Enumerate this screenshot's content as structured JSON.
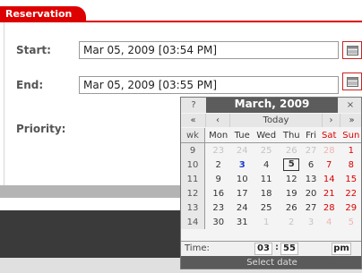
{
  "tab": {
    "label": "Reservation"
  },
  "form": {
    "start_label": "Start:",
    "start_value": "Mar 05, 2009 [03:54 PM]",
    "end_label": "End:",
    "end_value": "Mar 05, 2009 [03:55 PM]",
    "priority_label": "Priority:"
  },
  "calendar": {
    "help": "?",
    "close": "×",
    "title": "March, 2009",
    "nav": {
      "prev_year": "«",
      "prev_month": "‹",
      "today": "Today",
      "next_month": "›",
      "next_year": "»"
    },
    "headers": [
      "wk",
      "Mon",
      "Tue",
      "Wed",
      "Thu",
      "Fri",
      "Sat",
      "Sun"
    ],
    "weeks": [
      {
        "wk": "9",
        "days": [
          "23",
          "24",
          "25",
          "26",
          "27",
          "28",
          "1"
        ]
      },
      {
        "wk": "10",
        "days": [
          "2",
          "3",
          "4",
          "5",
          "6",
          "7",
          "8"
        ]
      },
      {
        "wk": "11",
        "days": [
          "9",
          "10",
          "11",
          "12",
          "13",
          "14",
          "15"
        ]
      },
      {
        "wk": "12",
        "days": [
          "16",
          "17",
          "18",
          "19",
          "20",
          "21",
          "22"
        ]
      },
      {
        "wk": "13",
        "days": [
          "23",
          "24",
          "25",
          "26",
          "27",
          "28",
          "29"
        ]
      },
      {
        "wk": "14",
        "days": [
          "30",
          "31",
          "1",
          "2",
          "3",
          "4",
          "5"
        ]
      }
    ],
    "selected_day": "5",
    "today_day": "3",
    "time_label": "Time:",
    "hour": "03",
    "minute": "55",
    "ampm": "pm",
    "status": "Select date"
  },
  "colors": {
    "accent": "#dd0000",
    "calendar_header": "#5c5c5c"
  }
}
